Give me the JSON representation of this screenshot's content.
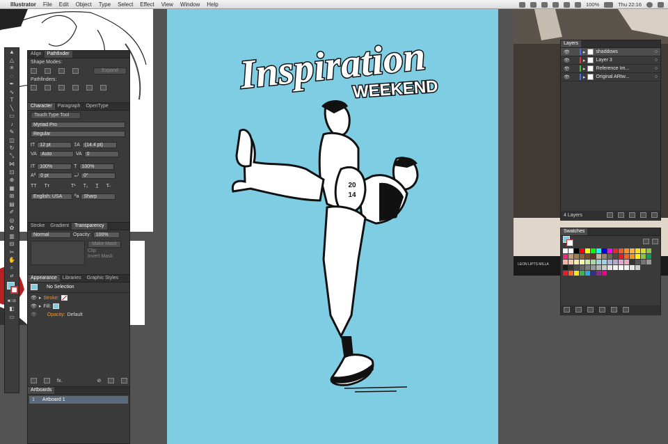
{
  "menubar": {
    "apple_glyph": "",
    "app": "Illustrator",
    "items": [
      "File",
      "Edit",
      "Object",
      "Type",
      "Select",
      "Effect",
      "View",
      "Window",
      "Help"
    ],
    "battery": "100%",
    "clock": "Thu 22:16"
  },
  "align_panel": {
    "tabs": [
      "Align",
      "Pathfinder"
    ],
    "shape_modes_label": "Shape Modes:",
    "expand_label": "Expand",
    "pathfinders_label": "Pathfinders:"
  },
  "character_panel": {
    "tabs": [
      "Character",
      "Paragraph",
      "OpenType"
    ],
    "touch_type": "Touch Type Tool",
    "font": "Myriad Pro",
    "style": "Regular",
    "size": "12 pt",
    "leading": "(14.4 pt)",
    "kerning": "Auto",
    "tracking": "0",
    "vscale": "100%",
    "hscale": "100%",
    "baseline": "0 pt",
    "rotation": "0°",
    "language": "English: USA",
    "aa_label": "ªa",
    "antialias": "Sharp"
  },
  "transparency_panel": {
    "tabs": [
      "Stroke",
      "Gradient",
      "Transparency"
    ],
    "blend": "Normal",
    "opacity_label": "Opacity:",
    "opacity": "100%",
    "make_mask": "Make Mask",
    "clip": "Clip",
    "invert_mask": "Invert Mask"
  },
  "appearance_panel": {
    "tabs": [
      "Appearance",
      "Libraries",
      "Graphic Styles"
    ],
    "selection": "No Selection",
    "stroke_label": "Stroke:",
    "fill_label": "Fill:",
    "opacity_label": "Opacity:",
    "opacity_value": "Default"
  },
  "artboards_panel": {
    "title": "Artboards",
    "rows": [
      {
        "num": "1",
        "name": "Artboard 1"
      }
    ]
  },
  "layers_panel": {
    "title": "Layers",
    "layers": [
      {
        "name": "shaddows",
        "color": "#4f6bed",
        "selected": true
      },
      {
        "name": "Layer 3",
        "color": "#e83a3a",
        "selected": false
      },
      {
        "name": "Reference Im...",
        "color": "#3fbf3f",
        "selected": false
      },
      {
        "name": "Original ARtw...",
        "color": "#4f6bed",
        "selected": false
      }
    ],
    "count": "4 Layers"
  },
  "swatches_panel": {
    "title": "Swatches",
    "rows": [
      [
        "#ffffff",
        "#ffffff",
        "#000000",
        "#ff0000",
        "#ffff00",
        "#00ff00",
        "#00ffff",
        "#0000ff",
        "#ff00ff",
        "#e8262a",
        "#ef5a28",
        "#f7931e",
        "#fbb040",
        "#ffde17",
        "#d7df23",
        "#8dc63f",
        "#39b54a",
        "#009444",
        "#00a79d",
        "#27aae1",
        "#1c75bc",
        "#2e3192",
        "#662d91",
        "#92278f",
        "#9e1f63",
        "#da1c5c"
      ],
      [
        "#ee2a7b",
        "#c69c6d",
        "#a67c52",
        "#8c6239",
        "#754c24",
        "#603813",
        "#c7b299",
        "#998675",
        "#736357",
        "#534741",
        "#ed1c24",
        "#f26522",
        "#f7941d",
        "#fff200",
        "#8dc63f",
        "#00a651",
        "#00aeef",
        "#0072bc",
        "#2e3192",
        "#92278f",
        "#ec008c",
        "#ed145b",
        "#ffffff",
        "#cccccc",
        "#999999",
        "#666666"
      ],
      [
        "#fbb4a6",
        "#fccba6",
        "#fde8a8",
        "#f6f7a8",
        "#d0e6a5",
        "#a8d8a8",
        "#9ed7d8",
        "#a0cfe8",
        "#a7b6dc",
        "#b8a7d3",
        "#e3a7d0",
        "#f0a7c0",
        "#333333",
        "#555555",
        "#777777",
        "#999999",
        "#bbbbbb",
        "#dddddd",
        "#ff3333",
        "#ff9933",
        "#ffff33",
        "#33cc33",
        "#3399ff",
        "#9933ff"
      ],
      [
        "#1a1a1a",
        "#333333",
        "#4d4d4d",
        "#666666",
        "#808080",
        "#999999",
        "#b3b3b3",
        "#cccccc",
        "#e6e6e6",
        "#f2f2f2",
        "#ffffff",
        "#f2f2f2",
        "#e6e6e6",
        "#cccccc"
      ],
      [
        "#ed1c24",
        "#f26522",
        "#ffde17",
        "#39b54a",
        "#27aae1",
        "#2e3192",
        "#92278f",
        "#ec008c"
      ]
    ]
  },
  "artwork": {
    "headline": "Inspiration",
    "subhead": "WEEKEND",
    "badge_top": "20",
    "badge_bottom": "14"
  },
  "reference_caption": "LEON LIPTS MILLA"
}
